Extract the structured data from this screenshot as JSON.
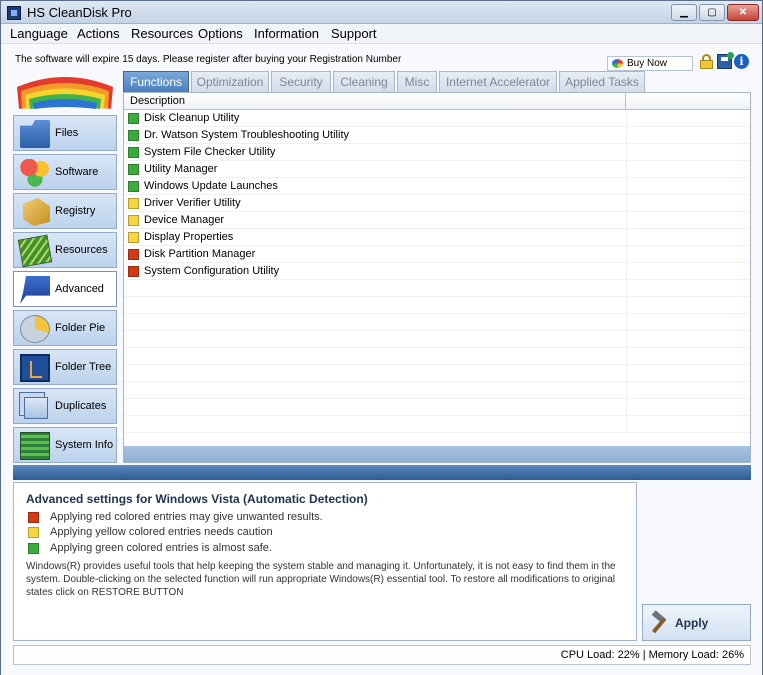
{
  "window": {
    "title": "HS CleanDisk Pro"
  },
  "menu": [
    "Language",
    "Actions",
    "Resources",
    "Options",
    "Information",
    "Support"
  ],
  "notice": "The software will expire 15 days. Please register after buying your Registration Number",
  "buy_now": "Buy Now",
  "sidebar": [
    {
      "label": "Files",
      "icon": "folder-icon"
    },
    {
      "label": "Software",
      "icon": "software-icon"
    },
    {
      "label": "Registry",
      "icon": "registry-icon"
    },
    {
      "label": "Resources",
      "icon": "resources-icon"
    },
    {
      "label": "Advanced",
      "icon": "advanced-icon",
      "active": true
    },
    {
      "label": "Folder Pie",
      "icon": "folder-pie-icon"
    },
    {
      "label": "Folder Tree",
      "icon": "folder-tree-icon"
    },
    {
      "label": "Duplicates",
      "icon": "duplicates-icon"
    },
    {
      "label": "System Info",
      "icon": "system-info-icon"
    }
  ],
  "tabs": [
    "Functions",
    "Optimization",
    "Security",
    "Cleaning",
    "Misc",
    "Internet Accelerator",
    "Applied Tasks"
  ],
  "active_tab": "Functions",
  "list": {
    "header": "Description",
    "rows": [
      {
        "text": "Disk Cleanup Utility",
        "color": "green"
      },
      {
        "text": "Dr. Watson System Troubleshooting Utility",
        "color": "green"
      },
      {
        "text": "System File Checker Utility",
        "color": "green"
      },
      {
        "text": "Utility Manager",
        "color": "green"
      },
      {
        "text": "Windows Update Launches",
        "color": "green"
      },
      {
        "text": "Driver Verifier Utility",
        "color": "yellow"
      },
      {
        "text": "Device Manager",
        "color": "yellow"
      },
      {
        "text": "Display Properties",
        "color": "yellow"
      },
      {
        "text": "Disk Partition Manager",
        "color": "red"
      },
      {
        "text": "System Configuration Utility",
        "color": "red"
      }
    ]
  },
  "info": {
    "title": "Advanced settings for  Windows Vista (Automatic Detection)",
    "legend": [
      {
        "color": "red",
        "text": "Applying red colored entries may give unwanted results."
      },
      {
        "color": "yellow",
        "text": "Applying yellow colored entries needs caution"
      },
      {
        "color": "green",
        "text": "Applying green colored entries is almost safe."
      }
    ],
    "description": "Windows(R) provides useful tools that help keeping the system stable and managing it. Unfortunately, it is not easy to find them in the system. Double-clicking on the selected function will run appropriate Windows(R) essential tool. To restore all modifications to original states click on RESTORE BUTTON"
  },
  "apply_label": "Apply",
  "status": {
    "text": "CPU Load: 22%  |  Memory Load: 26%"
  },
  "colors": {
    "red": "#d23a16",
    "yellow": "#f6d640",
    "green": "#3daa3d",
    "accent": "#4a7fbe"
  }
}
